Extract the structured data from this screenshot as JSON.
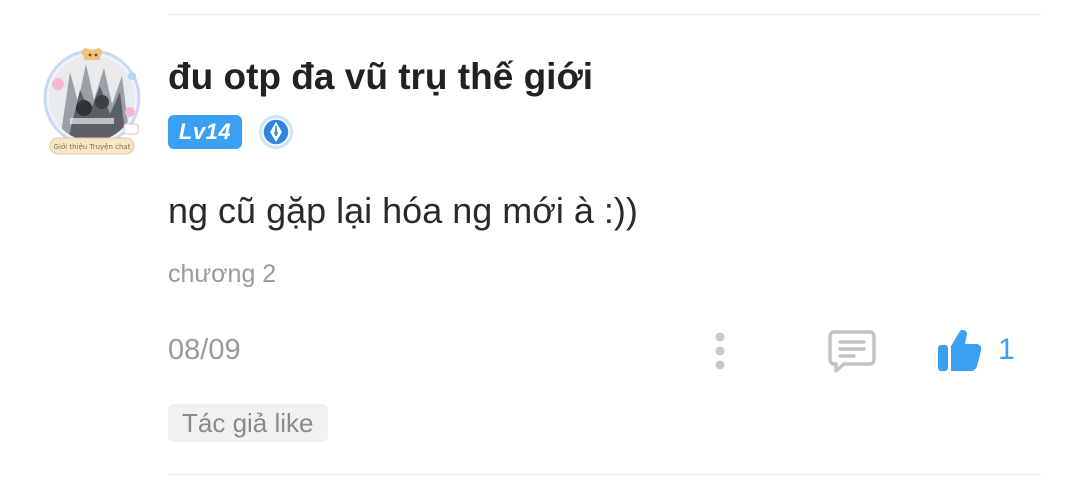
{
  "comment": {
    "username": "đu otp đa vũ trụ thế giới",
    "level": "Lv14",
    "text": "ng cũ gặp lại hóa ng mới à :))",
    "chapter": "chương 2",
    "date": "08/09",
    "likes": "1",
    "author_tag": "Tác giả like",
    "avatar_frame_text": "Giới thiệu Truyện chat"
  },
  "icons": {
    "more": "more-vertical-icon",
    "reply": "comment-reply-icon",
    "like": "thumbs-up-icon",
    "rank": "pen-nib-rank-icon"
  },
  "colors": {
    "accent": "#3aa0f2",
    "text": "#222222",
    "muted": "#9a9a9a"
  }
}
